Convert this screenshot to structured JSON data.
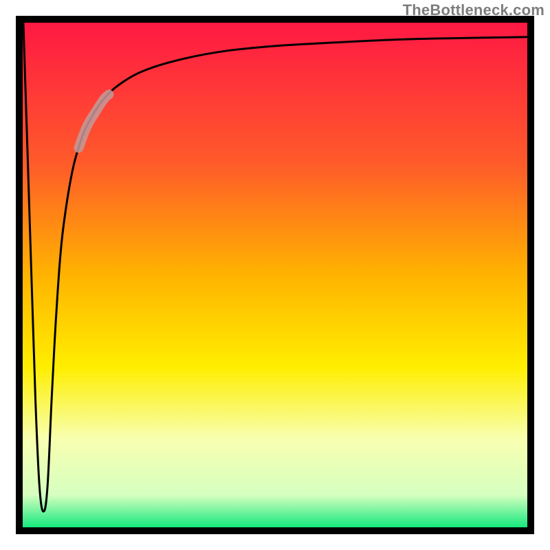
{
  "watermark": "TheBottleneck.com",
  "chart_data": {
    "type": "line",
    "title": "",
    "xlabel": "",
    "ylabel": "",
    "xlim": [
      0,
      100
    ],
    "ylim": [
      0,
      100
    ],
    "grid": false,
    "legend": false,
    "background_gradient": {
      "stops": [
        {
          "offset": 0.0,
          "color": "#ff1744"
        },
        {
          "offset": 0.28,
          "color": "#ff5a2a"
        },
        {
          "offset": 0.5,
          "color": "#ffb300"
        },
        {
          "offset": 0.68,
          "color": "#ffee00"
        },
        {
          "offset": 0.82,
          "color": "#f8ffb0"
        },
        {
          "offset": 0.93,
          "color": "#d6ffc0"
        },
        {
          "offset": 1.0,
          "color": "#00e676"
        }
      ]
    },
    "series": [
      {
        "name": "bottleneck-curve",
        "x": [
          0.0,
          0.8,
          1.6,
          2.4,
          3.2,
          4.0,
          4.8,
          5.6,
          6.4,
          7.2,
          8.0,
          9.6,
          11.2,
          12.8,
          16.0,
          20.0,
          25.0,
          32.0,
          40.0,
          50.0,
          62.0,
          75.0,
          88.0,
          100.0
        ],
        "y": [
          100.0,
          75.0,
          50.0,
          25.0,
          8.0,
          3.0,
          8.0,
          25.0,
          40.0,
          52.0,
          60.0,
          70.0,
          76.0,
          80.0,
          85.0,
          88.5,
          91.0,
          93.0,
          94.5,
          95.5,
          96.2,
          96.8,
          97.1,
          97.3
        ]
      }
    ],
    "highlight_segment": {
      "series": "bottleneck-curve",
      "x_start": 11.0,
      "x_end": 17.0
    },
    "frame_stroke_width": 10
  }
}
